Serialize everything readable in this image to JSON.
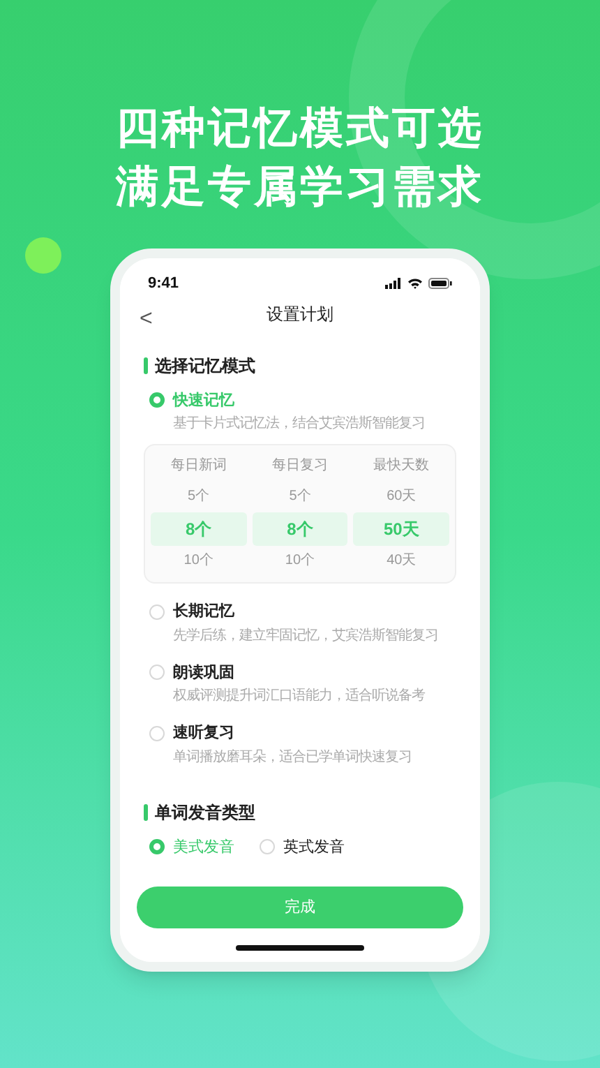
{
  "headline": [
    "四种记忆模式可选",
    "满足专属学习需求"
  ],
  "status_bar": {
    "time": "9:41"
  },
  "nav": {
    "back": "<",
    "title": "设置计划"
  },
  "mode_section": {
    "title": "选择记忆模式",
    "modes": [
      {
        "name": "快速记忆",
        "description": "基于卡片式记忆法，结合艾宾浩斯智能复习",
        "selected": true
      },
      {
        "name": "长期记忆",
        "description": "先学后练，建立牢固记忆，艾宾浩斯智能复习",
        "selected": false
      },
      {
        "name": "朗读巩固",
        "description": "权威评测提升词汇口语能力，适合听说备考",
        "selected": false
      },
      {
        "name": "速听复习",
        "description": "单词播放磨耳朵，适合已学单词快速复习",
        "selected": false
      }
    ],
    "picker": [
      {
        "header": "每日新词",
        "options": [
          {
            "label": "5个",
            "selected": false
          },
          {
            "label": "8个",
            "selected": true
          },
          {
            "label": "10个",
            "selected": false
          }
        ]
      },
      {
        "header": "每日复习",
        "options": [
          {
            "label": "5个",
            "selected": false
          },
          {
            "label": "8个",
            "selected": true
          },
          {
            "label": "10个",
            "selected": false
          }
        ]
      },
      {
        "header": "最快天数",
        "options": [
          {
            "label": "60天",
            "selected": false
          },
          {
            "label": "50天",
            "selected": true
          },
          {
            "label": "40天",
            "selected": false
          }
        ]
      }
    ]
  },
  "pronunciation_section": {
    "title": "单词发音类型",
    "options": [
      {
        "label": "美式发音",
        "selected": true
      },
      {
        "label": "英式发音",
        "selected": false
      }
    ]
  },
  "done_button": "完成"
}
